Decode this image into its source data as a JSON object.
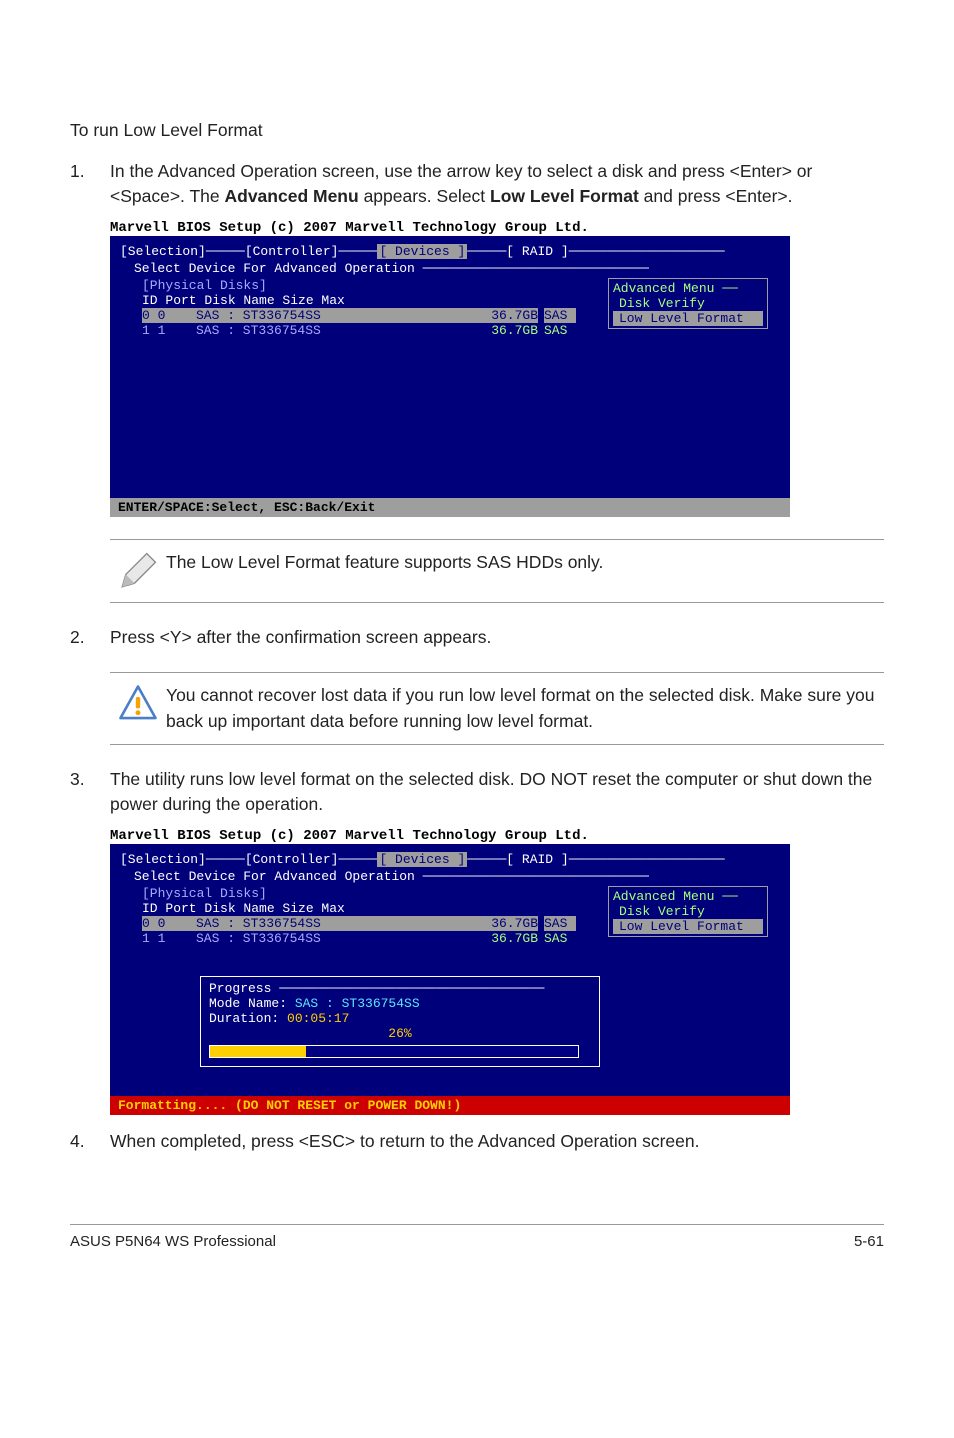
{
  "title": "To run Low Level Format",
  "steps": {
    "s1": {
      "num": "1.",
      "text_a": "In the Advanced Operation screen, use the arrow key to select a disk and press <Enter> or <Space>. The ",
      "b1": "Advanced Menu",
      "text_b": " appears. Select ",
      "b2": "Low Level Format",
      "text_c": " and press <Enter>."
    },
    "s2": {
      "num": "2.",
      "text": "Press <Y> after the confirmation screen appears."
    },
    "s3": {
      "num": "3.",
      "text": "The utility runs low level format on the selected disk. DO NOT reset the computer or shut down the power during the operation."
    },
    "s4": {
      "num": "4.",
      "text": "When completed, press <ESC> to return to the Advanced Operation screen."
    }
  },
  "bios": {
    "caption": "Marvell BIOS Setup (c) 2007 Marvell Technology Group Ltd.",
    "tabline_a": "[Selection]─────[Controller]─────",
    "tab_active": "[ Devices ]",
    "tabline_b": "─────[  RAID  ]────────────────────",
    "subhead": "Select Device For Advanced Operation ─────────────────────────────",
    "physical": "[Physical Disks]",
    "colhead": "ID Port  Disk Name                            Size    Max",
    "row0": {
      "id": " 0  0  ",
      "name": " SAS : ST336754SS",
      "size": "36.7GB",
      "type": "SAS"
    },
    "row1": {
      "id": " 1  1  ",
      "name": " SAS : ST336754SS",
      "size": "36.7GB",
      "type": "SAS"
    },
    "advmenu": {
      "title": "Advanced Menu ──",
      "opt1": " Disk Verify",
      "opt2": " Low Level Format "
    },
    "status1": "ENTER/SPACE:Select, ESC:Back/Exit",
    "progress": {
      "title": "Progress ──────────────────────────────────",
      "mode_label": " Mode Name:",
      "mode_val": "   SAS  :  ST336754SS",
      "dur_label": " Duration:",
      "dur_val": "    00:05:17",
      "pct": "26%",
      "fill_width": "26%"
    },
    "status2": "Formatting.... (DO NOT RESET or POWER DOWN!)"
  },
  "notes": {
    "n1": "The Low Level Format feature supports SAS HDDs only.",
    "n2": "You cannot recover lost data if you run low level format on the selected disk. Make sure you back up important data before running low level format."
  },
  "footer": {
    "left": "ASUS P5N64 WS Professional",
    "right": "5-61"
  }
}
